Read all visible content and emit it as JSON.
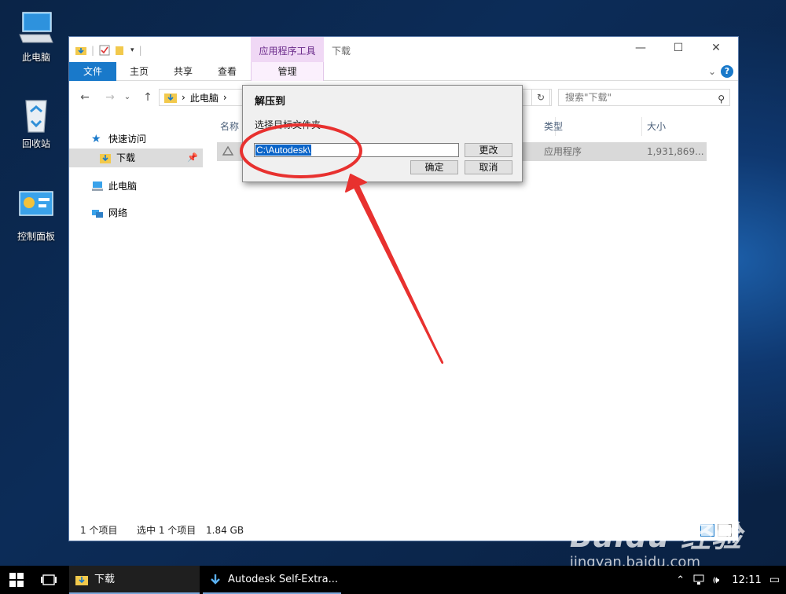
{
  "desktop": {
    "icons": [
      {
        "label": "此电脑"
      },
      {
        "label": "回收站"
      },
      {
        "label": "控制面板"
      }
    ]
  },
  "explorer": {
    "window_title": "下载",
    "contextual_tab_header": "应用程序工具",
    "ribbon_tabs": {
      "file": "文件",
      "home": "主页",
      "share": "共享",
      "view": "查看",
      "manage": "管理"
    },
    "address": {
      "crumb_root": "此电脑",
      "separator": "›"
    },
    "search_placeholder": "搜索\"下载\"",
    "nav_pane": {
      "quick_access": "快速访问",
      "downloads": "下载",
      "this_pc": "此电脑",
      "network": "网络"
    },
    "columns": {
      "name": "名称",
      "type": "类型",
      "size": "大小"
    },
    "file_row": {
      "type": "应用程序",
      "size": "1,931,869..."
    },
    "status": {
      "item_count": "1 个项目",
      "selected": "选中 1 个项目",
      "selected_size": "1.84 GB"
    }
  },
  "dialog": {
    "title": "解压到",
    "label": "选择目标文件夹",
    "path_value": "C:\\Autodesk\\",
    "change_button": "更改",
    "ok_button": "确定",
    "cancel_button": "取消"
  },
  "taskbar": {
    "items": [
      {
        "label": "下载"
      },
      {
        "label": "Autodesk Self-Extra..."
      }
    ],
    "clock": "12:11"
  },
  "watermark": {
    "brand": "Baidu 经验",
    "url": "jingyan.baidu.com"
  },
  "colors": {
    "accent": "#1979ca",
    "annotation": "#e8312f",
    "selection": "#0a64c8"
  }
}
